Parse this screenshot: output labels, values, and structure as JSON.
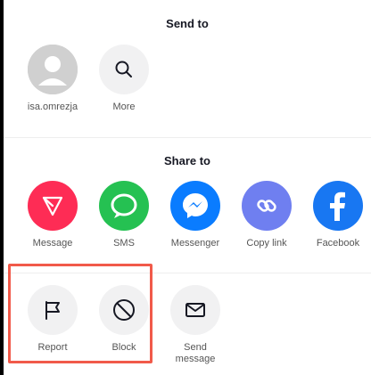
{
  "send_to": {
    "title": "Send to",
    "contacts": [
      {
        "label": "isa.omrezja",
        "icon": "avatar-placeholder-icon"
      },
      {
        "label": "More",
        "icon": "search-icon"
      }
    ]
  },
  "share_to": {
    "title": "Share to",
    "apps": [
      {
        "label": "Message",
        "icon": "send-triangle-icon",
        "color": "#fe2c55"
      },
      {
        "label": "SMS",
        "icon": "sms-bubble-icon",
        "color": "#25c152"
      },
      {
        "label": "Messenger",
        "icon": "messenger-icon",
        "color": "#0a7cff"
      },
      {
        "label": "Copy link",
        "icon": "link-icon",
        "color": "#6f7ff0"
      },
      {
        "label": "Facebook",
        "icon": "facebook-icon",
        "color": "#1877f2"
      }
    ]
  },
  "actions": {
    "items": [
      {
        "label": "Report",
        "icon": "flag-icon"
      },
      {
        "label": "Block",
        "icon": "block-icon"
      },
      {
        "label": "Send message",
        "icon": "envelope-icon"
      }
    ]
  },
  "colors": {
    "highlight": "#f15a4a",
    "neutral_circle": "#f1f1f2"
  }
}
